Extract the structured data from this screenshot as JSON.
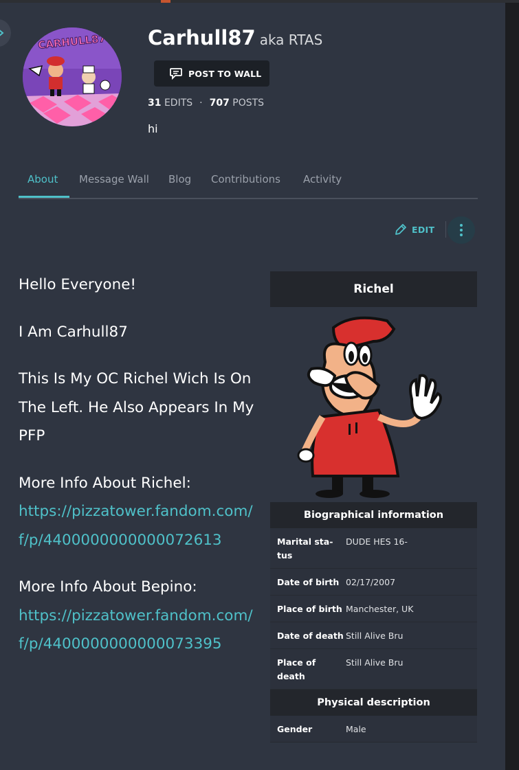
{
  "profile": {
    "username": "Carhull87",
    "aka_prefix": "aka",
    "aka_name": "RTAS",
    "post_to_wall_label": "POST TO WALL",
    "edits_count": "31",
    "edits_label": "EDITS",
    "posts_count": "707",
    "posts_label": "POSTS",
    "stats_separator": "·",
    "bio": "hi",
    "avatar_text": "CARHULL87"
  },
  "tabs": [
    {
      "label": "About",
      "active": true
    },
    {
      "label": "Message Wall",
      "active": false
    },
    {
      "label": "Blog",
      "active": false
    },
    {
      "label": "Contributions",
      "active": false
    },
    {
      "label": "Activity",
      "active": false
    }
  ],
  "actions": {
    "edit_label": "EDIT"
  },
  "about": {
    "greeting": "Hello Everyone!",
    "intro": "I Am Carhull87",
    "oc_text": "This Is My OC Richel Wich Is On The Left. He Also Appears In My PFP",
    "richel_heading": "More Info About Richel:",
    "richel_link": "https://pizzatower.fandom.com/f/p/4400000000000072613",
    "bepino_heading": "More Info About Bepino:",
    "bepino_link": "https://pizzatower.fandom.com/f/p/4400000000000073395"
  },
  "infobox": {
    "title": "Richel",
    "bio_section": "Biographical information",
    "rows": [
      {
        "label": "Marital sta-tus",
        "value": "DUDE HES 16-"
      },
      {
        "label": "Date of birth",
        "value": "02/17/2007"
      },
      {
        "label": "Place of birth",
        "value": "Manchester, UK"
      },
      {
        "label": "Date of death",
        "value": "Still Alive Bru"
      },
      {
        "label": "Place of death",
        "value": "Still Alive Bru"
      }
    ],
    "physical_section": "Physical description",
    "physical_rows": [
      {
        "label": "Gender",
        "value": "Male"
      }
    ]
  },
  "colors": {
    "accent": "#4fc1c9",
    "panel": "#2f3541",
    "background": "#1c1d20"
  }
}
